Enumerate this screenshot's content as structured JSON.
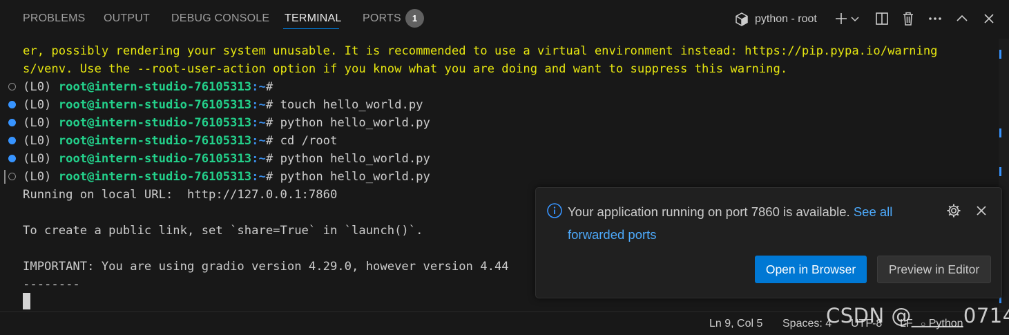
{
  "panel": {
    "tabs": [
      {
        "label": "PROBLEMS"
      },
      {
        "label": "OUTPUT"
      },
      {
        "label": "DEBUG CONSOLE"
      },
      {
        "label": "TERMINAL"
      },
      {
        "label": "PORTS"
      }
    ],
    "active_tab": "TERMINAL",
    "ports_badge": "1",
    "terminal_name": "python - root",
    "actions": [
      "new-terminal-icon",
      "chevron-down-icon",
      "split-terminal-icon",
      "trash-icon",
      "ellipsis-icon",
      "chevron-up-icon",
      "close-icon"
    ]
  },
  "terminal": {
    "warning_lines": [
      "er, possibly rendering your system unusable. It is recommended to use a virtual environment instead: https://pip.pypa.io/warning",
      "s/venv. Use the --root-user-action option if you know what you are doing and want to suppress this warning."
    ],
    "prompt": {
      "env": "(L0)",
      "user_host": "root@intern-studio-76105313",
      "path": ":~",
      "symbol": "#"
    },
    "commands": [
      {
        "cmd": "",
        "marker": "hollow"
      },
      {
        "cmd": "touch hello_world.py",
        "marker": "filled"
      },
      {
        "cmd": "python hello_world.py",
        "marker": "filled"
      },
      {
        "cmd": "cd /root",
        "marker": "filled"
      },
      {
        "cmd": "python hello_world.py",
        "marker": "filled"
      },
      {
        "cmd": "python hello_world.py",
        "marker": "hollow"
      }
    ],
    "output_lines": [
      "Running on local URL:  http://127.0.0.1:7860",
      "",
      "To create a public link, set `share=True` in `launch()`.",
      "",
      "IMPORTANT: You are using gradio version 4.29.0, however version 4.44",
      "--------"
    ]
  },
  "notification": {
    "message": "Your application running on port 7860 is available.",
    "link_part1": "See all",
    "link_part2": "forwarded ports",
    "primary_button": "Open in Browser",
    "secondary_button": "Preview in Editor"
  },
  "statusbar": {
    "position": "Ln 9, Col 5",
    "spaces": "Spaces: 4",
    "encoding": "UTF-8",
    "eol": "LF",
    "language": "Python"
  },
  "watermark": "CSDN @_____0714",
  "colors": {
    "accent": "#0078d4",
    "warning_text": "#e5e510",
    "prompt_user": "#23d18b",
    "prompt_path": "#3b8eea",
    "link": "#4daafc"
  }
}
